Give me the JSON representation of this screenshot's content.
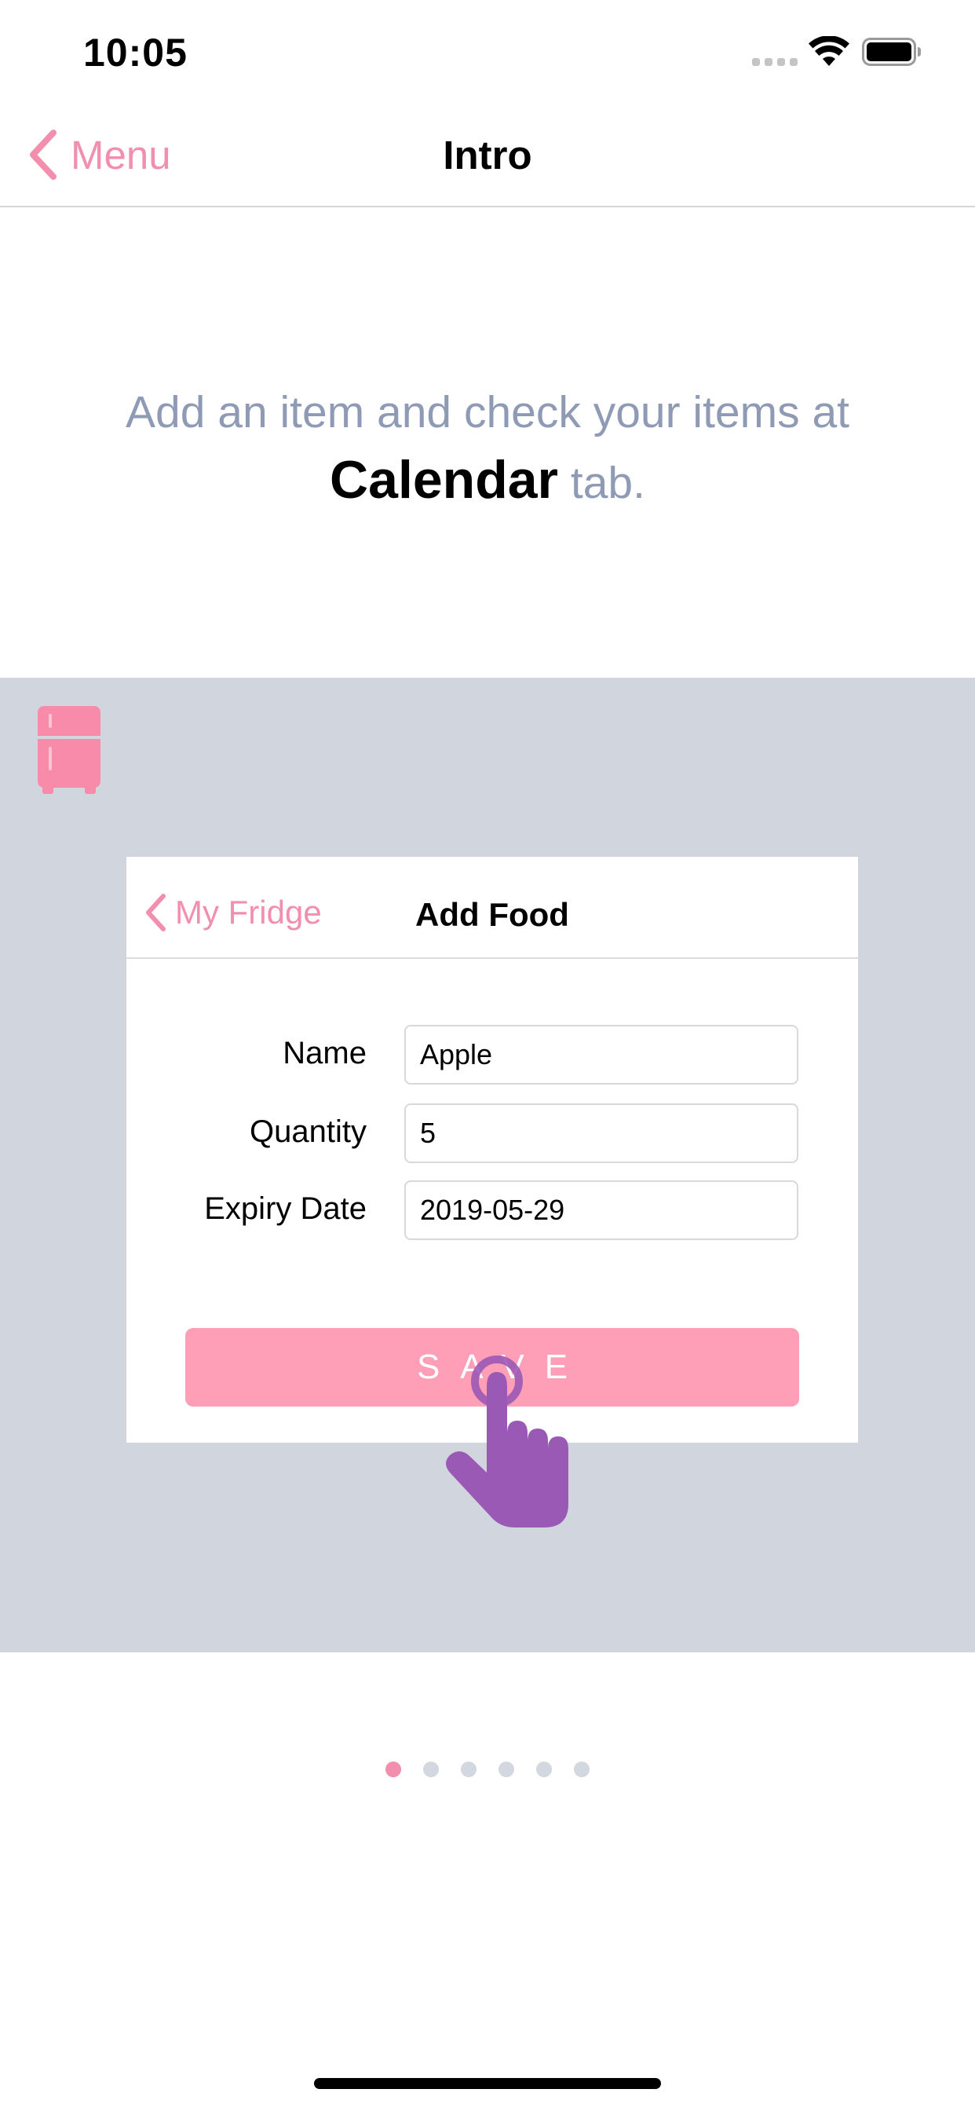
{
  "status_bar": {
    "time": "10:05"
  },
  "nav": {
    "back_label": "Menu",
    "title": "Intro"
  },
  "intro": {
    "line1": "Add an item and check your items at",
    "highlight": "Calendar",
    "line2_suffix": " tab."
  },
  "demo": {
    "icon": "fridge-icon",
    "mini_nav": {
      "back_label": "My Fridge",
      "title": "Add Food"
    },
    "form": {
      "name_label": "Name",
      "name_value": "Apple",
      "quantity_label": "Quantity",
      "quantity_value": "5",
      "expiry_label": "Expiry Date",
      "expiry_value": "2019-05-29"
    },
    "save_label": "SAVE",
    "pointer_icon": "tap-hand-icon"
  },
  "pagination": {
    "total_pages": 6,
    "current_page": 1
  },
  "colors": {
    "accent_pink": "#f38fae",
    "save_button": "#ff9fb7",
    "panel_background": "#d0d5de",
    "intro_text": "#8f9bb4",
    "hand_purple": "#9b59b6"
  }
}
